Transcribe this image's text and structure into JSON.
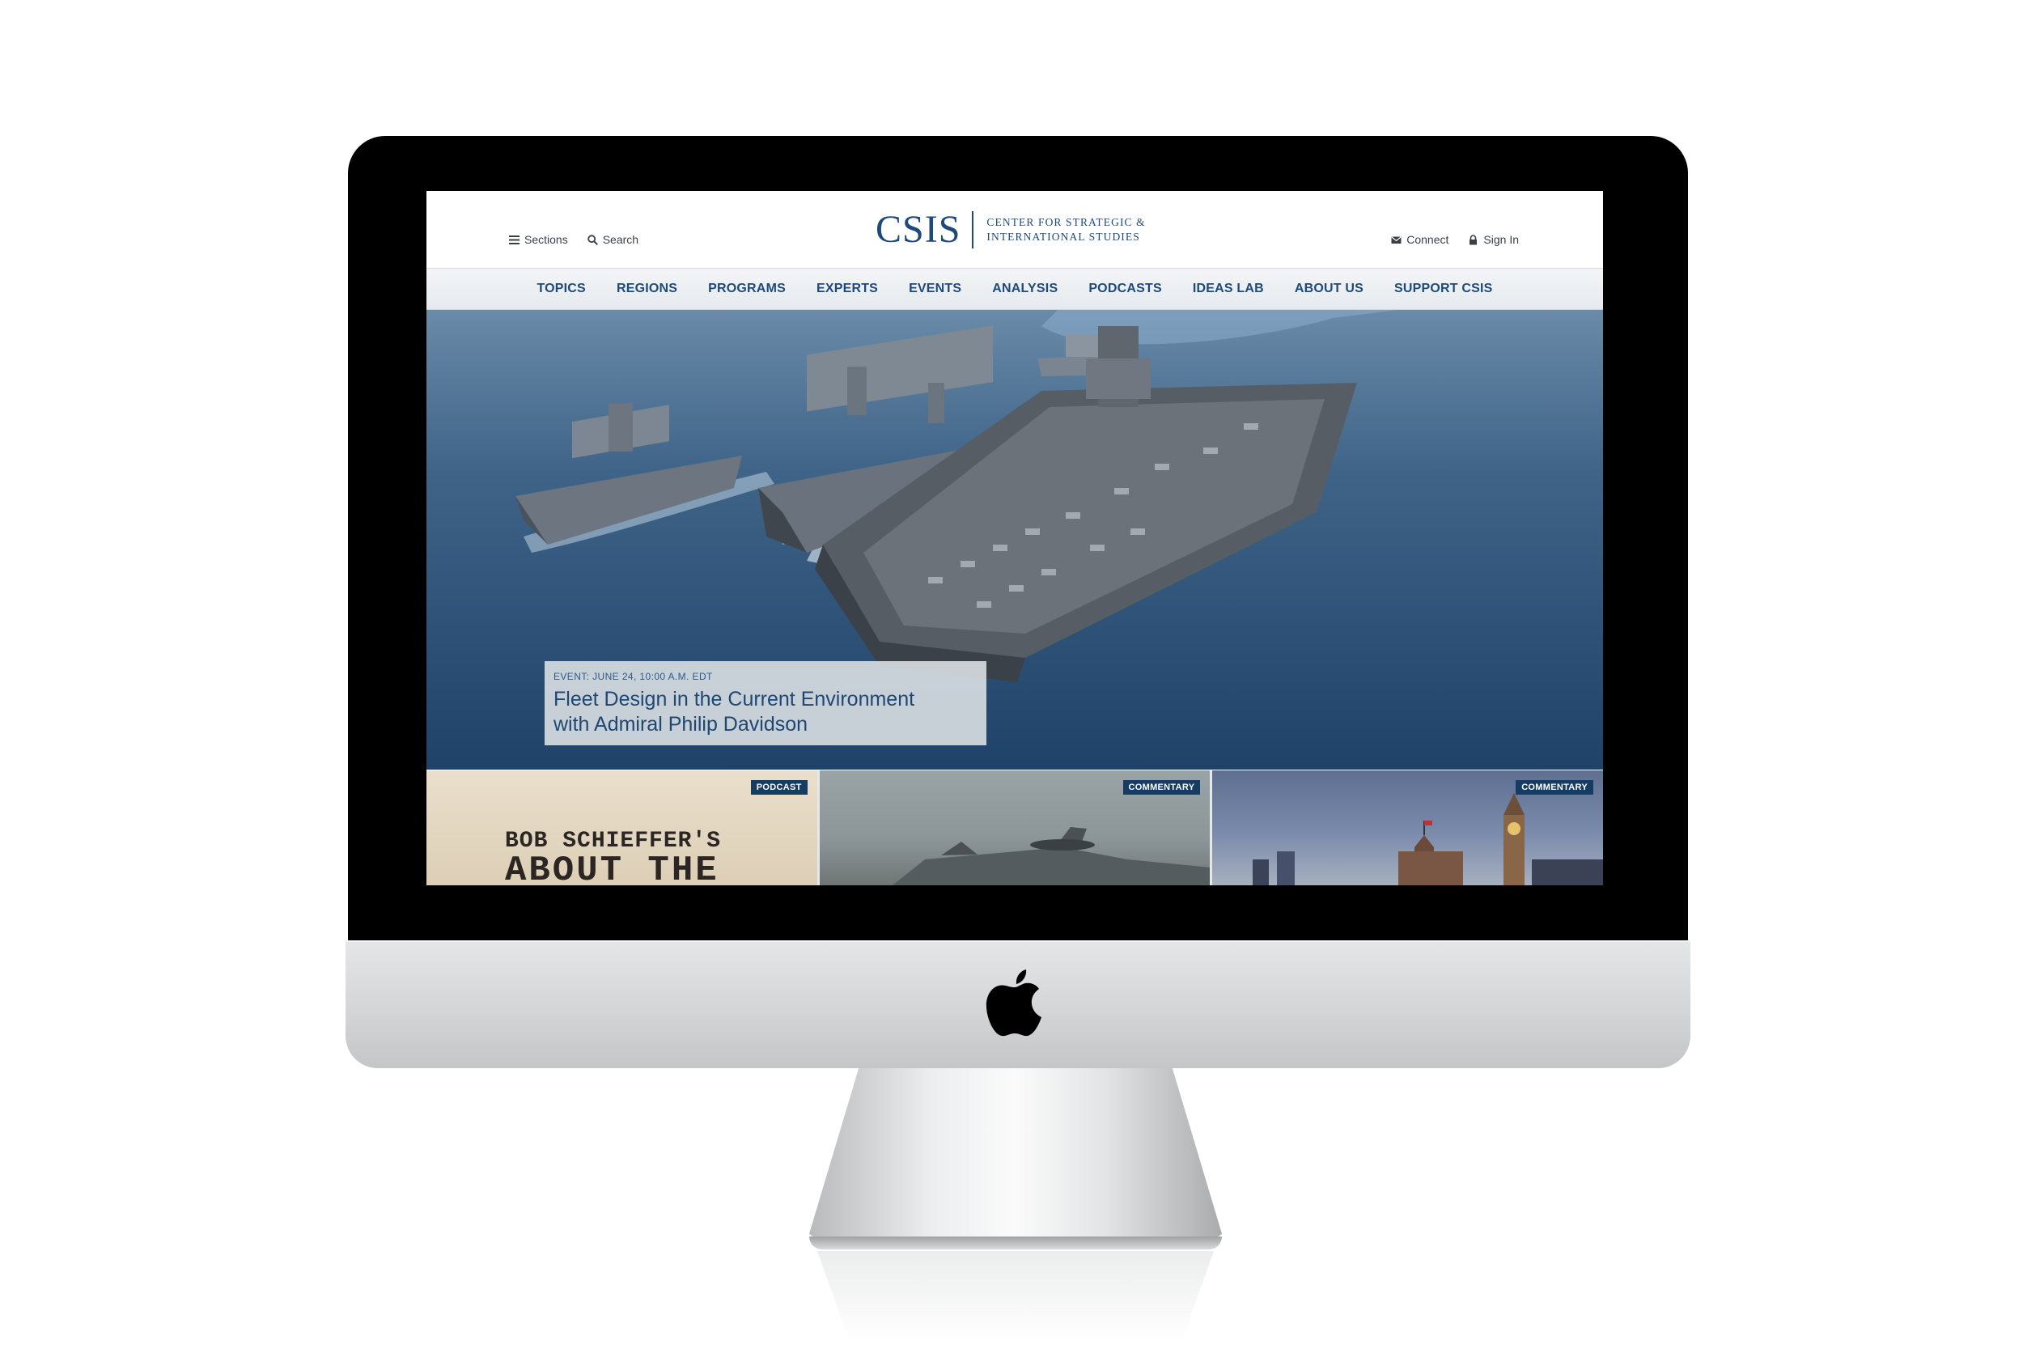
{
  "header": {
    "sections_label": "Sections",
    "search_label": "Search",
    "connect_label": "Connect",
    "signin_label": "Sign In",
    "logo_mark": "CSIS",
    "logo_line1": "CENTER FOR STRATEGIC &",
    "logo_line2": "INTERNATIONAL STUDIES"
  },
  "nav": {
    "items": [
      "TOPICS",
      "REGIONS",
      "PROGRAMS",
      "EXPERTS",
      "EVENTS",
      "ANALYSIS",
      "PODCASTS",
      "IDEAS LAB",
      "ABOUT US",
      "SUPPORT CSIS"
    ]
  },
  "hero": {
    "kicker": "EVENT: JUNE 24, 10:00 A.M. EDT",
    "title_line1": "Fleet Design in the Current Environment",
    "title_line2": "with Admiral Philip Davidson"
  },
  "cards": [
    {
      "tag": "PODCAST",
      "title_line1": "BOB SCHIEFFER'S",
      "title_line2": "ABOUT THE"
    },
    {
      "tag": "COMMENTARY"
    },
    {
      "tag": "COMMENTARY"
    }
  ],
  "colors": {
    "brand_blue": "#1d4a7a",
    "tag_navy": "#163c63",
    "nav_bg": "#e9edf1"
  }
}
